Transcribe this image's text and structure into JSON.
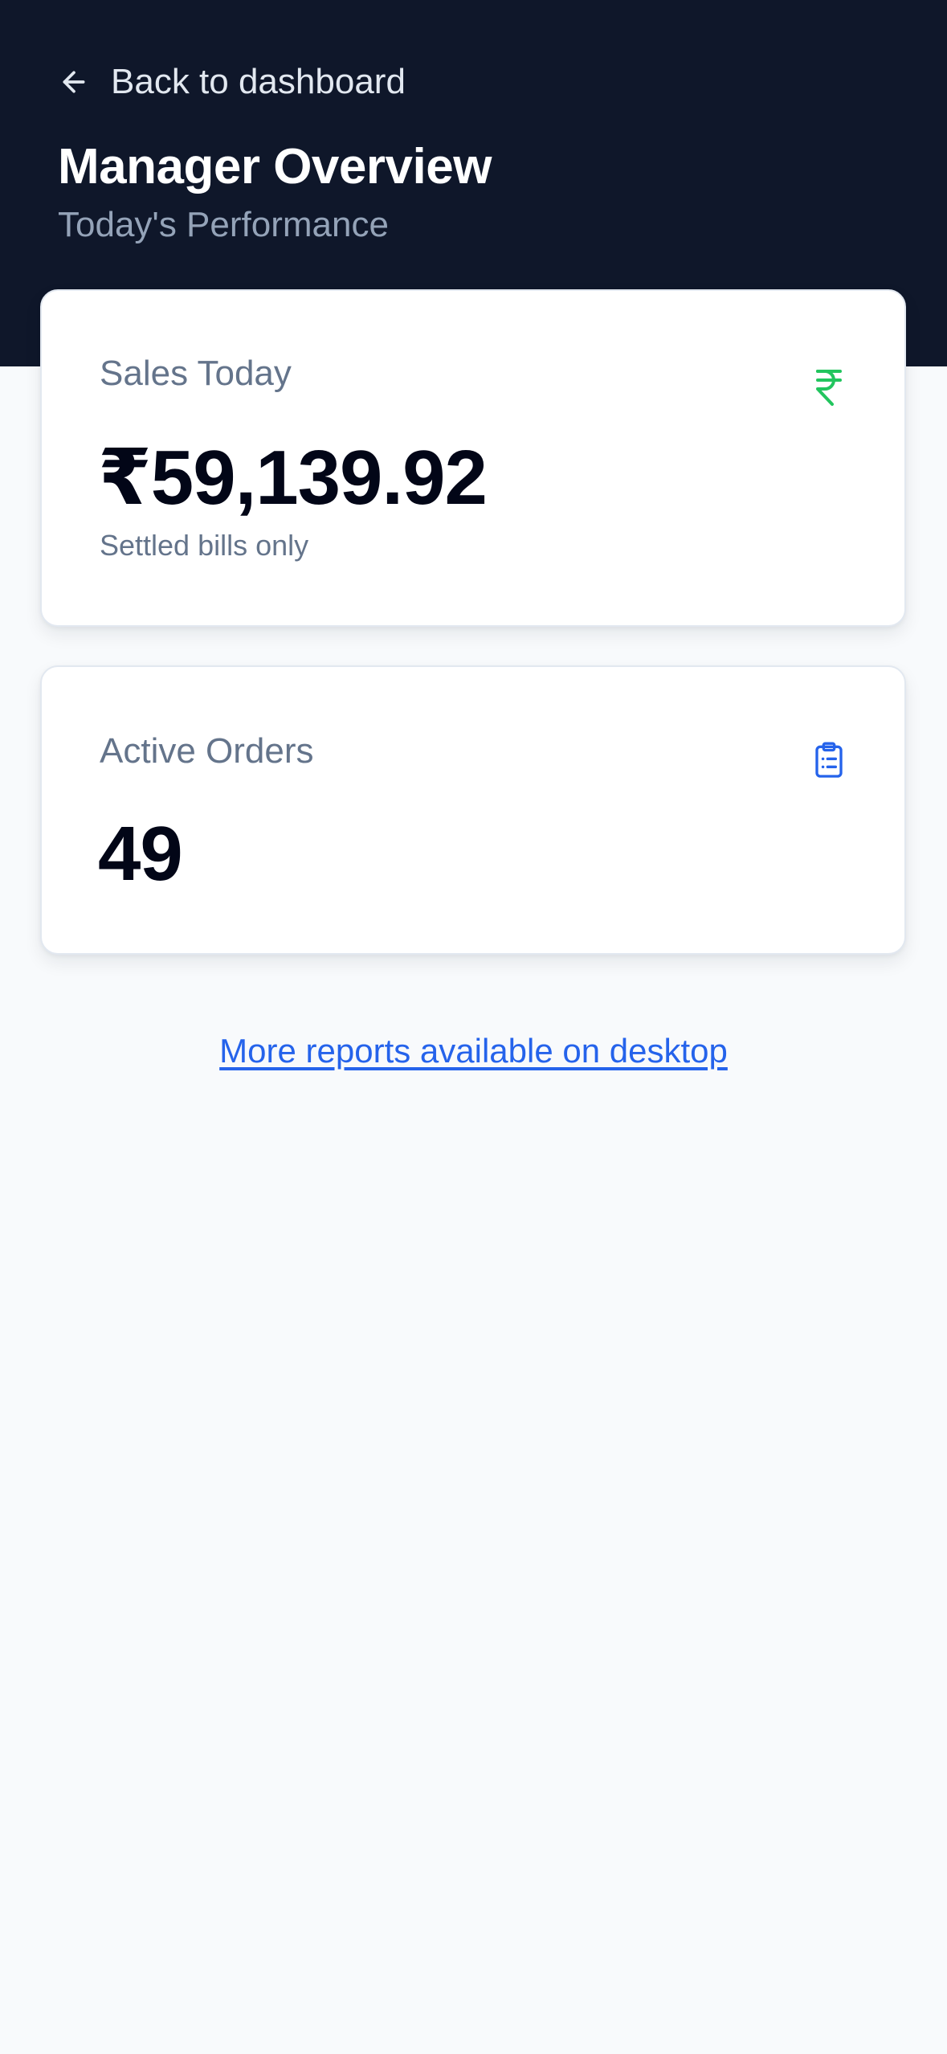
{
  "header": {
    "back_label": "Back to dashboard",
    "back_icon": "arrow-left-icon",
    "title": "Manager Overview",
    "subtitle": "Today's Performance"
  },
  "cards": {
    "sales": {
      "label": "Sales Today",
      "value": "₹59,139.92",
      "note": "Settled bills only",
      "icon": "rupee-icon",
      "icon_color": "#22c55e"
    },
    "orders": {
      "label": "Active Orders",
      "value": "49",
      "icon": "clipboard-list-icon",
      "icon_color": "#2563eb"
    }
  },
  "footer": {
    "reports_link": "More reports available on desktop"
  },
  "colors": {
    "header_bg": "#0f172a",
    "page_bg": "#f8fafc",
    "link": "#2563eb"
  }
}
